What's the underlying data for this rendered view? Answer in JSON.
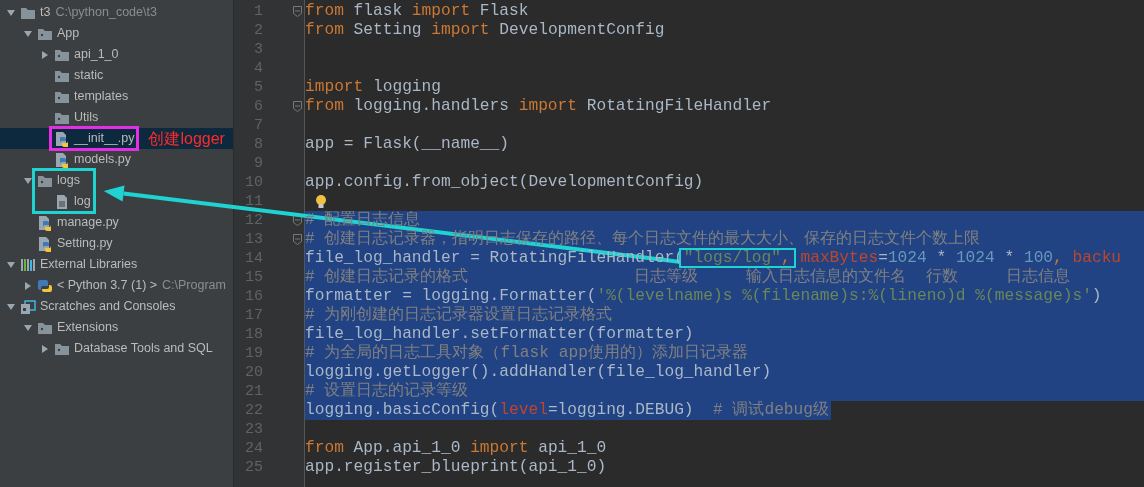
{
  "project_tree": [
    {
      "label": "t3",
      "kind": "project",
      "path": "C:\\python_code\\t3",
      "expanded": true,
      "selected": false,
      "children": [
        {
          "label": "App",
          "kind": "folder",
          "expanded": true,
          "selected": false,
          "children": [
            {
              "label": "api_1_0",
              "kind": "folder",
              "expanded": false,
              "selected": false
            },
            {
              "label": "static",
              "kind": "folder",
              "selected": false
            },
            {
              "label": "templates",
              "kind": "folder",
              "selected": false
            },
            {
              "label": "Utils",
              "kind": "folder",
              "selected": false
            },
            {
              "label": "__init__.py",
              "kind": "python",
              "selected": true,
              "boxed": true,
              "color": "#e52de5",
              "note": "创建logger"
            },
            {
              "label": "models.py",
              "kind": "python",
              "selected": false
            }
          ]
        },
        {
          "label": "logs",
          "kind": "folder",
          "expanded": true,
          "selected": false,
          "boxed": true,
          "color": "#1fd3d3",
          "arrow_target": true,
          "children": [
            {
              "label": "log",
              "kind": "text",
              "selected": false
            }
          ]
        },
        {
          "label": "manage.py",
          "kind": "python",
          "selected": false
        },
        {
          "label": "Setting.py",
          "kind": "python",
          "selected": false
        }
      ]
    },
    {
      "label": "External Libraries",
      "kind": "libraries",
      "expanded": true,
      "selected": false,
      "children": [
        {
          "label": "< Python 3.7 (1) >",
          "kind": "sdk",
          "path": "C:\\Program",
          "expanded": false,
          "selected": false
        }
      ]
    },
    {
      "label": "Scratches and Consoles",
      "kind": "scratches",
      "expanded": true,
      "selected": false,
      "children": [
        {
          "label": "Extensions",
          "kind": "folder",
          "expanded": true,
          "selected": false,
          "children": [
            {
              "label": "Database Tools and SQL",
              "kind": "folder",
              "expanded": false,
              "selected": false
            }
          ]
        }
      ]
    }
  ],
  "editor": {
    "lines": [
      {
        "number": "1",
        "fold": true,
        "selected": false,
        "tokens": [
          {
            "kind": "keyword",
            "text": "from"
          },
          {
            "kind": "plain",
            "text": " flask "
          },
          {
            "kind": "keyword",
            "text": "import"
          },
          {
            "kind": "plain",
            "text": " Flask"
          }
        ]
      },
      {
        "number": "2",
        "selected": false,
        "tokens": [
          {
            "kind": "keyword",
            "text": "from"
          },
          {
            "kind": "plain",
            "text": " Setting "
          },
          {
            "kind": "keyword",
            "text": "import"
          },
          {
            "kind": "plain",
            "text": " DevelopmentConfig"
          }
        ]
      },
      {
        "number": "3",
        "selected": false
      },
      {
        "number": "4",
        "selected": false
      },
      {
        "number": "5",
        "selected": false,
        "tokens": [
          {
            "kind": "keyword",
            "text": "import"
          },
          {
            "kind": "plain",
            "text": " logging"
          }
        ]
      },
      {
        "number": "6",
        "fold": true,
        "selected": false,
        "tokens": [
          {
            "kind": "keyword",
            "text": "from"
          },
          {
            "kind": "plain",
            "text": " logging.handlers "
          },
          {
            "kind": "keyword",
            "text": "import"
          },
          {
            "kind": "plain",
            "text": " RotatingFileHandler"
          }
        ]
      },
      {
        "number": "7",
        "selected": false
      },
      {
        "number": "8",
        "selected": false,
        "tokens": [
          {
            "kind": "plain",
            "text": "app = Flask(__name__)"
          }
        ]
      },
      {
        "number": "9",
        "selected": false
      },
      {
        "number": "10",
        "selected": false,
        "tokens": [
          {
            "kind": "plain",
            "text": "app.config.from_object(DevelopmentConfig)"
          }
        ]
      },
      {
        "number": "11",
        "selected": false,
        "bulb": true
      },
      {
        "number": "12",
        "fold": true,
        "selected": true,
        "tokens": [
          {
            "kind": "comment",
            "text": "# 配置日志信息"
          }
        ]
      },
      {
        "number": "13",
        "fold": true,
        "selected": true,
        "tokens": [
          {
            "kind": "comment",
            "text": "# 创建日志记录器，指明日志保存的路径、每个日志文件的最大大小、保存的日志文件个数上限"
          }
        ]
      },
      {
        "number": "14",
        "selected": true,
        "tokens": [
          {
            "kind": "plain",
            "text": "file_log_handler = RotatingFileHandler("
          },
          {
            "kind": "string",
            "text": "\"logs/log\"",
            "boxed": true,
            "color": "#1fd3d3"
          },
          {
            "kind": "keyword",
            "text": ",",
            "boxed": true,
            "color": "#1fd3d3"
          },
          {
            "kind": "param",
            "text": " maxBytes"
          },
          {
            "kind": "plain",
            "text": "="
          },
          {
            "kind": "number",
            "text": "1024"
          },
          {
            "kind": "plain",
            "text": " * "
          },
          {
            "kind": "number",
            "text": "1024"
          },
          {
            "kind": "plain",
            "text": " * "
          },
          {
            "kind": "number",
            "text": "100"
          },
          {
            "kind": "keyword",
            "text": ","
          },
          {
            "kind": "param",
            "text": " backu"
          }
        ]
      },
      {
        "number": "15",
        "selected": true,
        "tokens": [
          {
            "kind": "comment",
            "text": "# 创建日志记录的格式                 日志等级     输入日志信息的文件名  行数     日志信息"
          }
        ]
      },
      {
        "number": "16",
        "selected": true,
        "tokens": [
          {
            "kind": "plain",
            "text": "formatter = logging.Formatter("
          },
          {
            "kind": "string",
            "text": "'%(levelname)s %(filename)s:%(lineno)d %(message)s'"
          },
          {
            "kind": "plain",
            "text": ")"
          }
        ]
      },
      {
        "number": "17",
        "selected": true,
        "tokens": [
          {
            "kind": "comment",
            "text": "# 为刚创建的日志记录器设置日志记录格式"
          }
        ]
      },
      {
        "number": "18",
        "selected": true,
        "tokens": [
          {
            "kind": "plain",
            "text": "file_log_handler.setFormatter(formatter)"
          }
        ]
      },
      {
        "number": "19",
        "selected": true,
        "tokens": [
          {
            "kind": "comment",
            "text": "# 为全局的日志工具对象（flask app使用的）添加日记录器"
          }
        ]
      },
      {
        "number": "20",
        "selected": true,
        "tokens": [
          {
            "kind": "plain",
            "text": "logging.getLogger().addHandler(file_log_handler)"
          }
        ]
      },
      {
        "number": "21",
        "selected": true,
        "tokens": [
          {
            "kind": "comment",
            "text": "# 设置日志的记录等级"
          }
        ]
      },
      {
        "number": "22",
        "selected": true,
        "partial": true,
        "tokens": [
          {
            "kind": "plain",
            "text": "logging.basicConfig("
          },
          {
            "kind": "param",
            "text": "level"
          },
          {
            "kind": "plain",
            "text": "=logging.DEBUG)  "
          },
          {
            "kind": "comment",
            "text": "# 调试debug级"
          }
        ]
      },
      {
        "number": "23",
        "selected": false
      },
      {
        "number": "24",
        "selected": false,
        "tokens": [
          {
            "kind": "keyword",
            "text": "from"
          },
          {
            "kind": "plain",
            "text": " App.api_1_0 "
          },
          {
            "kind": "keyword",
            "text": "import"
          },
          {
            "kind": "plain",
            "text": " api_1_0"
          }
        ]
      },
      {
        "number": "25",
        "selected": false,
        "tokens": [
          {
            "kind": "plain",
            "text": "app.register_blueprint(api_1_0)"
          }
        ]
      }
    ]
  }
}
